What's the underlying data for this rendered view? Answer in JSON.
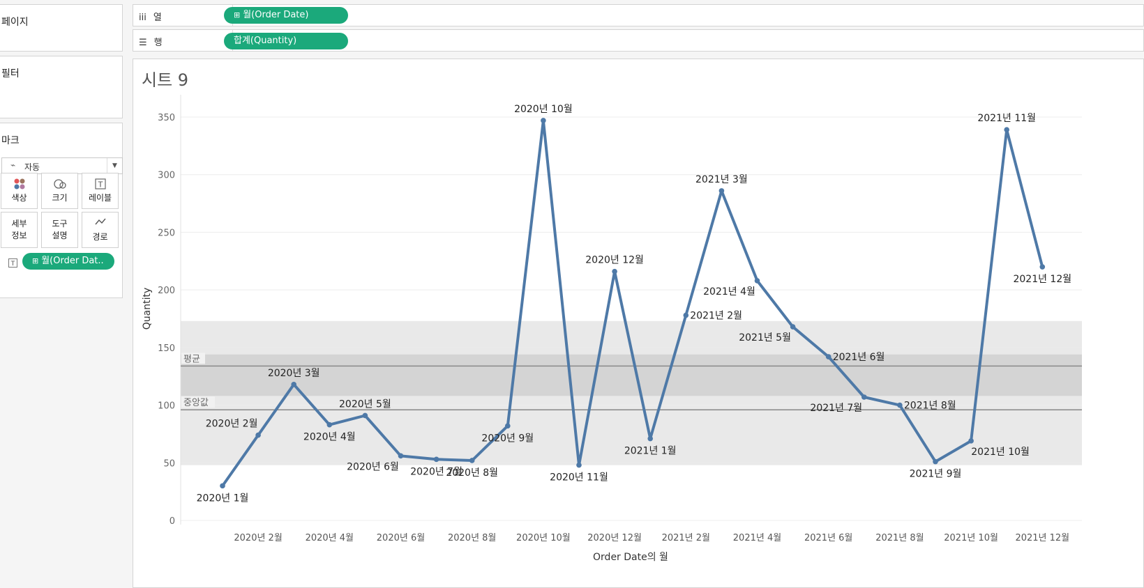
{
  "sidebar": {
    "pages_title": "페이지",
    "filters_title": "필터",
    "marks_title": "마크",
    "marks_type": "자동",
    "mark_buttons": [
      {
        "label": "색상",
        "icon": "color-icon"
      },
      {
        "label": "크기",
        "icon": "size-icon"
      },
      {
        "label": "레이블",
        "icon": "label-icon"
      },
      {
        "label": "세부\n정보",
        "icon": "detail-icon"
      },
      {
        "label": "도구\n설명",
        "icon": "tooltip-icon"
      },
      {
        "label": "경로",
        "icon": "path-icon"
      }
    ],
    "label_pill": "월(Order Dat.."
  },
  "shelves": {
    "columns_label": "열",
    "columns_pill": "월(Order Date)",
    "rows_label": "행",
    "rows_pill": "합계(Quantity)"
  },
  "sheet": {
    "title": "시트 9"
  },
  "colors": {
    "line": "#4e79a7",
    "pill": "#1ba97b",
    "band_outer": "#e9e9e9",
    "band_inner": "#d4d4d4",
    "ref_line": "#888888"
  },
  "chart_data": {
    "type": "line",
    "xlabel": "Order Date의 월",
    "ylabel": "Quantity",
    "ylim": [
      0,
      360
    ],
    "yticks": [
      0,
      50,
      100,
      150,
      200,
      250,
      300,
      350
    ],
    "xtick_labels": [
      "2020년 2월",
      "2020년 4월",
      "2020년 6월",
      "2020년 8월",
      "2020년 10월",
      "2020년 12월",
      "2021년 2월",
      "2021년 4월",
      "2021년 6월",
      "2021년 8월",
      "2021년 10월",
      "2021년 12월"
    ],
    "xtick_index": [
      1,
      3,
      5,
      7,
      9,
      11,
      13,
      15,
      17,
      19,
      21,
      23
    ],
    "categories": [
      "2020년 1월",
      "2020년 2월",
      "2020년 3월",
      "2020년 4월",
      "2020년 5월",
      "2020년 6월",
      "2020년 7월",
      "2020년 8월",
      "2020년 9월",
      "2020년 10월",
      "2020년 11월",
      "2020년 12월",
      "2021년 1월",
      "2021년 2월",
      "2021년 3월",
      "2021년 4월",
      "2021년 5월",
      "2021년 6월",
      "2021년 7월",
      "2021년 8월",
      "2021년 9월",
      "2021년 10월",
      "2021년 11월",
      "2021년 12월"
    ],
    "values": [
      30,
      74,
      118,
      83,
      91,
      56,
      53,
      52,
      82,
      347,
      48,
      216,
      71,
      178,
      286,
      208,
      168,
      142,
      107,
      100,
      51,
      69,
      339,
      220
    ],
    "label_position": [
      "below",
      "above-left",
      "above",
      "below",
      "above",
      "below-left",
      "below",
      "below",
      "below",
      "above",
      "below",
      "above",
      "below",
      "right",
      "above",
      "below-left",
      "below-left",
      "right",
      "below-left",
      "right",
      "below",
      "below-right",
      "above",
      "below"
    ],
    "reference_lines": [
      {
        "label": "평균",
        "value": 134
      },
      {
        "label": "중앙값",
        "value": 96
      }
    ],
    "bands": [
      {
        "from": 48,
        "to": 173,
        "shade": "outer"
      },
      {
        "from": 108,
        "to": 144,
        "shade": "inner"
      }
    ]
  }
}
